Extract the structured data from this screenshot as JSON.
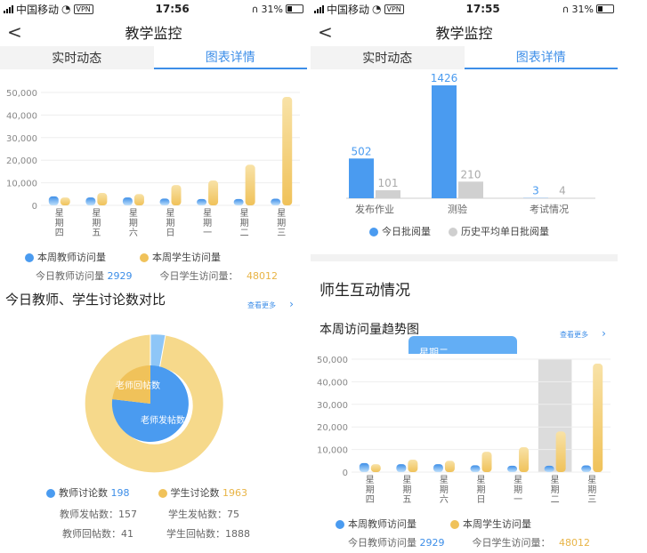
{
  "left": {
    "status": {
      "carrier": "中国移动",
      "vpn": "VPN",
      "time": "17:56",
      "battery": "31%"
    },
    "title": "教学监控",
    "tabs": [
      "实时动态",
      "图表详情"
    ],
    "active_tab": 1,
    "legend": {
      "teacher": "本周教师访问量",
      "student": "本周学生访问量"
    },
    "today": {
      "teacher_label": "今日教师访问量",
      "teacher_value": "2929",
      "student_label": "今日学生访问量：",
      "student_value": "48012"
    },
    "discussion_title": "今日教师、学生讨论数对比",
    "more": "查看更多",
    "donut_labels": {
      "reply": "老师回帖数",
      "post": "老师发帖数"
    },
    "disc_legend": {
      "teacher_label": "教师讨论数",
      "teacher_value": "198",
      "student_label": "学生讨论数",
      "student_value": "1963"
    },
    "stats": [
      [
        "教师发帖数：",
        "157",
        "学生发帖数：",
        "75"
      ],
      [
        "教师回帖数：",
        "41",
        "学生回帖数：",
        "1888"
      ]
    ]
  },
  "right": {
    "status": {
      "carrier": "中国移动",
      "vpn": "VPN",
      "time": "17:55",
      "battery": "31%"
    },
    "title": "教学监控",
    "tabs": [
      "实时动态",
      "图表详情"
    ],
    "active_tab": 1,
    "review_legend": {
      "a": "今日批阅量",
      "b": "历史平均单日批阅量"
    },
    "interaction_title": "师生互动情况",
    "trend_title": "本周访问量趋势图",
    "more": "查看更多",
    "tooltip": "星期二",
    "legend": {
      "teacher": "本周教师访问量",
      "student": "本周学生访问量"
    },
    "today": {
      "teacher_label": "今日教师访问量",
      "teacher_value": "2929",
      "student_label": "今日学生访问量：",
      "student_value": "48012"
    }
  },
  "colors": {
    "blue": "#4a9bf0",
    "orange": "#f0c25a",
    "gray": "#d0d0d0",
    "pale": "#f6d98b"
  },
  "chart_data": [
    {
      "type": "bar",
      "categories": [
        "星期四",
        "星期五",
        "星期六",
        "星期日",
        "星期一",
        "星期二",
        "星期三"
      ],
      "series": [
        {
          "name": "本周教师访问量",
          "values": [
            4000,
            3500,
            3500,
            3000,
            2800,
            2800,
            2929
          ]
        },
        {
          "name": "本周学生访问量",
          "values": [
            3500,
            5500,
            5000,
            9000,
            11000,
            18000,
            48012
          ]
        }
      ],
      "yticks": [
        "50,000",
        "40,000",
        "30,000",
        "20,000",
        "10,000",
        "0"
      ],
      "ylim": [
        0,
        50000
      ]
    },
    {
      "type": "bar",
      "categories": [
        "发布作业",
        "测验",
        "考试情况"
      ],
      "series": [
        {
          "name": "今日批阅量",
          "values": [
            502,
            1426,
            3
          ]
        },
        {
          "name": "历史平均单日批阅量",
          "values": [
            101,
            210,
            4
          ]
        }
      ],
      "labels_a": [
        "502",
        "1426",
        "3"
      ],
      "labels_b": [
        "101",
        "210",
        "4"
      ]
    },
    {
      "type": "pie",
      "labels": [
        "老师发帖数",
        "老师回帖数",
        "学生讨论数"
      ],
      "values": [
        157,
        41,
        1963
      ]
    },
    {
      "type": "bar",
      "categories": [
        "星期四",
        "星期五",
        "星期六",
        "星期日",
        "星期一",
        "星期二",
        "星期三"
      ],
      "series": [
        {
          "name": "本周教师访问量",
          "values": [
            4000,
            3500,
            3500,
            3000,
            2800,
            2800,
            2929
          ]
        },
        {
          "name": "本周学生访问量",
          "values": [
            3500,
            5500,
            5000,
            9000,
            11000,
            18000,
            48012
          ]
        }
      ],
      "yticks": [
        "50,000",
        "40,000",
        "30,000",
        "20,000",
        "10,000",
        "0"
      ],
      "ylim": [
        0,
        50000
      ],
      "highlight": "星期二"
    }
  ]
}
